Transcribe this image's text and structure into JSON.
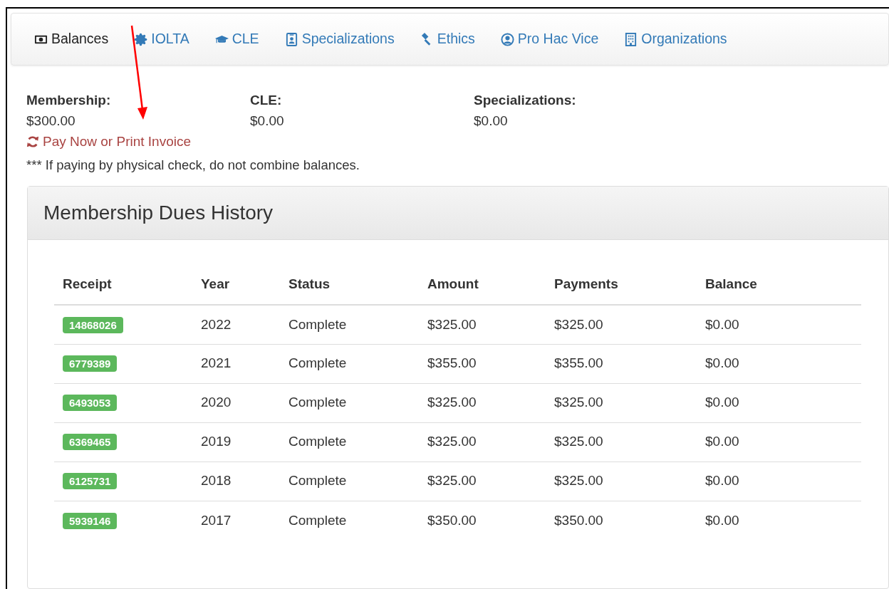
{
  "tabs": [
    {
      "label": "Balances",
      "selected": true
    },
    {
      "label": "IOLTA",
      "selected": false
    },
    {
      "label": "CLE",
      "selected": false
    },
    {
      "label": "Specializations",
      "selected": false
    },
    {
      "label": "Ethics",
      "selected": false
    },
    {
      "label": "Pro Hac Vice",
      "selected": false
    },
    {
      "label": "Organizations",
      "selected": false
    }
  ],
  "balances": [
    {
      "label": "Membership:",
      "amount": "$300.00"
    },
    {
      "label": "CLE:",
      "amount": "$0.00"
    },
    {
      "label": "Specializations:",
      "amount": "$0.00"
    }
  ],
  "pay_link": "Pay Now or Print Invoice",
  "note": "*** If paying by physical check, do not combine balances.",
  "panel": {
    "title": "Membership Dues History",
    "table": {
      "columns": [
        "Receipt",
        "Year",
        "Status",
        "Amount",
        "Payments",
        "Balance"
      ],
      "rows": [
        [
          "14868026",
          "2022",
          "Complete",
          "$325.00",
          "$325.00",
          "$0.00"
        ],
        [
          "6779389",
          "2021",
          "Complete",
          "$355.00",
          "$355.00",
          "$0.00"
        ],
        [
          "6493053",
          "2020",
          "Complete",
          "$325.00",
          "$325.00",
          "$0.00"
        ],
        [
          "6369465",
          "2019",
          "Complete",
          "$325.00",
          "$325.00",
          "$0.00"
        ],
        [
          "6125731",
          "2018",
          "Complete",
          "$325.00",
          "$325.00",
          "$0.00"
        ],
        [
          "5939146",
          "2017",
          "Complete",
          "$350.00",
          "$350.00",
          "$0.00"
        ]
      ]
    }
  }
}
